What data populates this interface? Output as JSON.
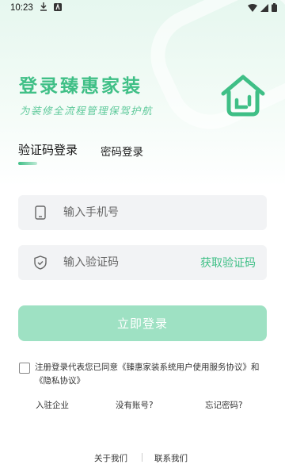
{
  "status_bar": {
    "time": "10:23"
  },
  "brand": {
    "title": "登录臻惠家装",
    "subtitle": "为装修全流程管理保驾护航",
    "accent_color": "#3fbf86"
  },
  "tabs": {
    "sms_login": "验证码登录",
    "password_login": "密码登录",
    "active": "sms_login"
  },
  "phone_input": {
    "placeholder": "输入手机号",
    "value": ""
  },
  "code_input": {
    "placeholder": "输入验证码",
    "value": ""
  },
  "get_code_label": "获取验证码",
  "login_button": "立即登录",
  "agreement": {
    "checked": false,
    "text": "注册登录代表您已同意《臻惠家装系统用户使用服务协议》和《隐私协议》"
  },
  "links": {
    "join_company": "入驻企业",
    "no_account": "没有账号?",
    "forgot_password": "忘记密码?"
  },
  "footer": {
    "about_us": "关于我们",
    "contact_us": "联系我们"
  }
}
